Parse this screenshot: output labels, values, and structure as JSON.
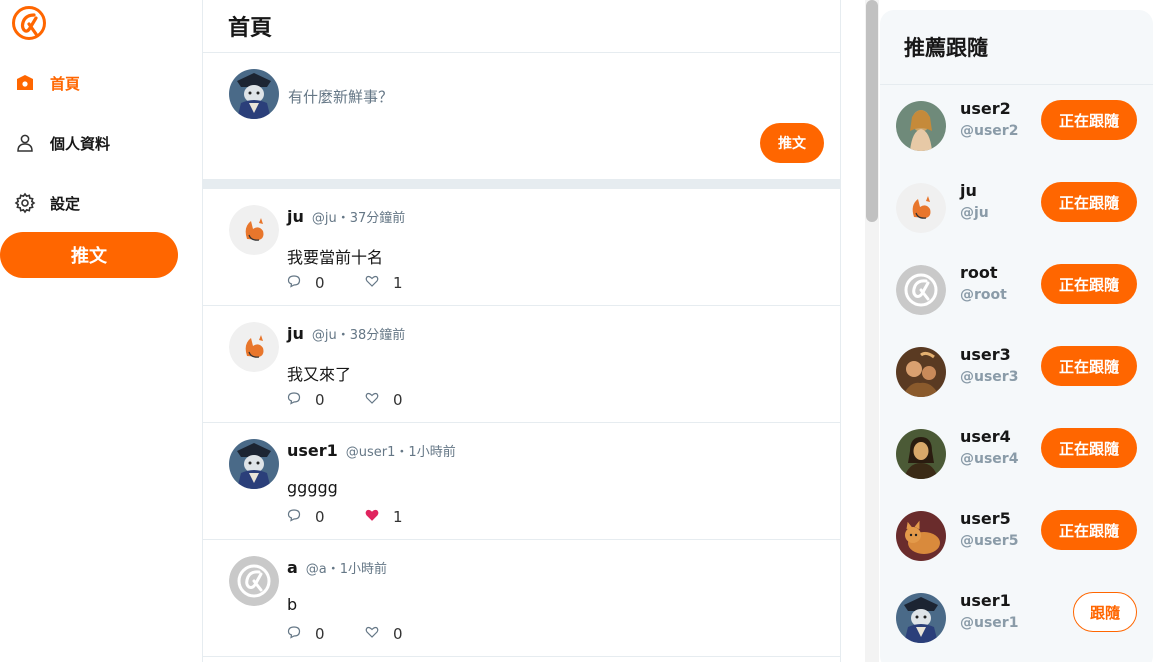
{
  "colors": {
    "accent": "#ff6600",
    "border": "#e6ecf0",
    "muted": "#657786",
    "panel_bg": "#f5f8fa"
  },
  "sidebar": {
    "logo_icon": "alpha-camp-logo",
    "items": [
      {
        "label": "首頁",
        "icon": "home-icon",
        "active": true
      },
      {
        "label": "個人資料",
        "icon": "user-icon",
        "active": false
      },
      {
        "label": "設定",
        "icon": "gear-icon",
        "active": false
      }
    ],
    "tweet_button": "推文"
  },
  "main": {
    "title": "首頁",
    "composer": {
      "placeholder": "有什麼新鮮事？",
      "button": "推文"
    },
    "tweets": [
      {
        "name": "ju",
        "meta": "@ju・37分鐘前",
        "body": "我要當前十名",
        "replies": "0",
        "likes": "1",
        "liked": false,
        "avatar": "fox"
      },
      {
        "name": "ju",
        "meta": "@ju・38分鐘前",
        "body": "我又來了",
        "replies": "0",
        "likes": "0",
        "liked": false,
        "avatar": "fox"
      },
      {
        "name": "user1",
        "meta": "@user1・1小時前",
        "body": "ggggg",
        "replies": "0",
        "likes": "1",
        "liked": true,
        "avatar": "portrait"
      },
      {
        "name": "a",
        "meta": "@a・1小時前",
        "body": "b",
        "replies": "0",
        "likes": "0",
        "liked": false,
        "avatar": "default"
      }
    ]
  },
  "recommend": {
    "title": "推薦跟隨",
    "users": [
      {
        "name": "user2",
        "handle": "@user2",
        "button": "正在跟隨",
        "following": true,
        "avatar": "venus"
      },
      {
        "name": "ju",
        "handle": "@ju",
        "button": "正在跟隨",
        "following": true,
        "avatar": "fox"
      },
      {
        "name": "root",
        "handle": "@root",
        "button": "正在跟隨",
        "following": true,
        "avatar": "default"
      },
      {
        "name": "user3",
        "handle": "@user3",
        "button": "正在跟隨",
        "following": true,
        "avatar": "painting-warm"
      },
      {
        "name": "user4",
        "handle": "@user4",
        "button": "正在跟隨",
        "following": true,
        "avatar": "mona"
      },
      {
        "name": "user5",
        "handle": "@user5",
        "button": "正在跟隨",
        "following": true,
        "avatar": "cat"
      },
      {
        "name": "user1",
        "handle": "@user1",
        "button": "跟隨",
        "following": false,
        "avatar": "portrait"
      }
    ]
  }
}
